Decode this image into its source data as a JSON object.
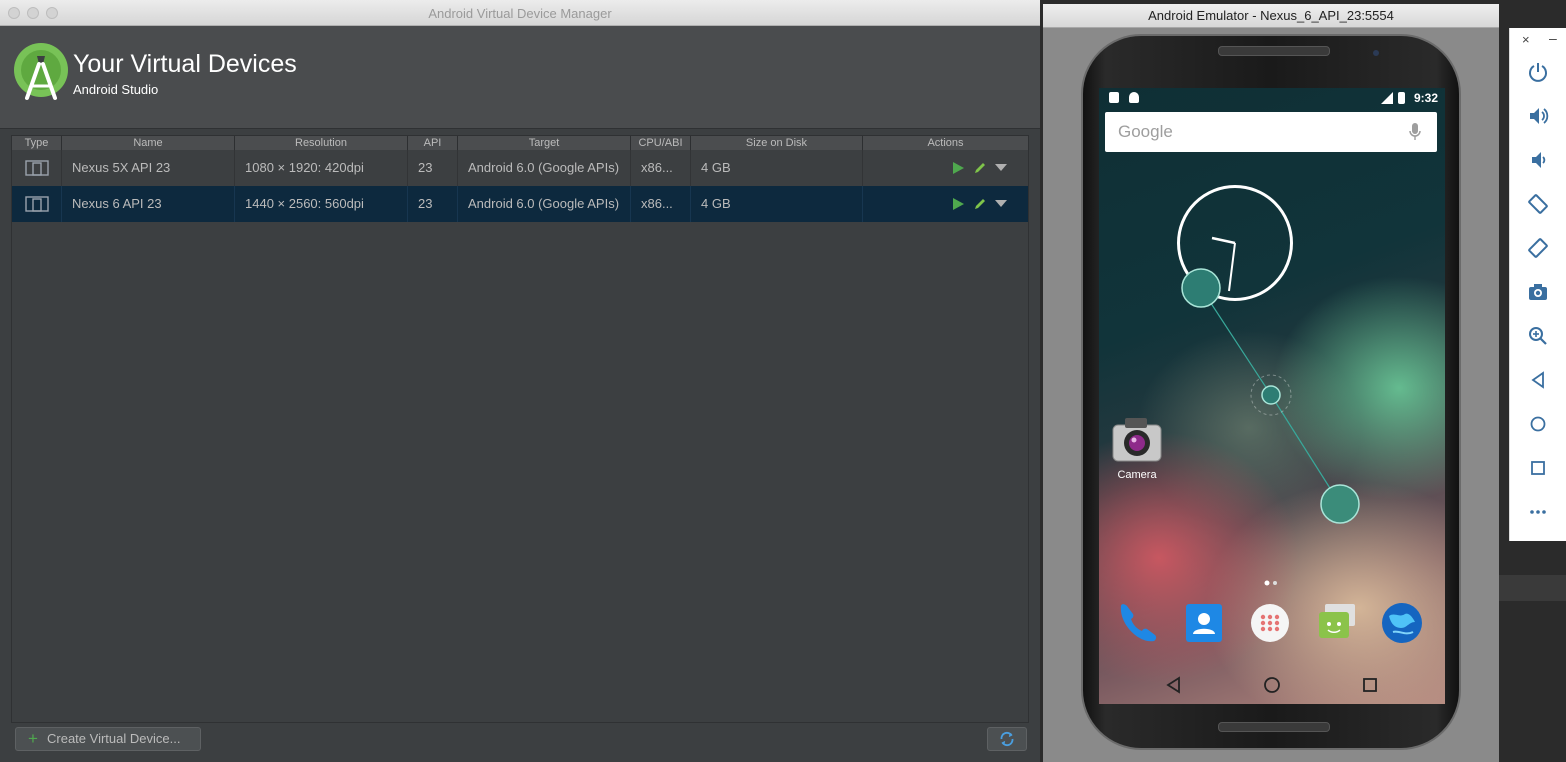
{
  "avd_window": {
    "title": "Android Virtual Device Manager",
    "header": {
      "title": "Your Virtual Devices",
      "subtitle": "Android Studio"
    },
    "columns": [
      "Type",
      "Name",
      "Resolution",
      "API",
      "Target",
      "CPU/ABI",
      "Size on Disk",
      "Actions"
    ],
    "rows": [
      {
        "name": "Nexus 5X API 23",
        "resolution": "1080 × 1920: 420dpi",
        "api": "23",
        "target": "Android 6.0 (Google APIs)",
        "cpu": "x86...",
        "size": "4 GB",
        "selected": false
      },
      {
        "name": "Nexus 6 API 23",
        "resolution": "1440 × 2560: 560dpi",
        "api": "23",
        "target": "Android 6.0 (Google APIs)",
        "cpu": "x86...",
        "size": "4 GB",
        "selected": true
      }
    ],
    "create_button": "Create Virtual Device...",
    "colors": {
      "accent_green": "#4fa84e",
      "selection": "#0d293e",
      "background": "#3c3f41"
    }
  },
  "emulator_window": {
    "title": "Android Emulator - Nexus_6_API_23:5554",
    "status_time": "9:32",
    "search_brand": "Google",
    "camera_label": "Camera",
    "dock_apps": [
      "phone-icon",
      "contacts-icon",
      "app-drawer-icon",
      "messaging-icon",
      "browser-icon"
    ],
    "nav_buttons": [
      "back-icon",
      "home-icon",
      "recents-icon"
    ]
  },
  "emulator_toolbar": {
    "close": "×",
    "minimize": "–",
    "buttons": [
      "power-icon",
      "volume-up-icon",
      "volume-down-icon",
      "rotate-left-icon",
      "rotate-right-icon",
      "screenshot-icon",
      "zoom-icon",
      "back-icon",
      "home-icon",
      "overview-icon",
      "more-icon"
    ]
  }
}
